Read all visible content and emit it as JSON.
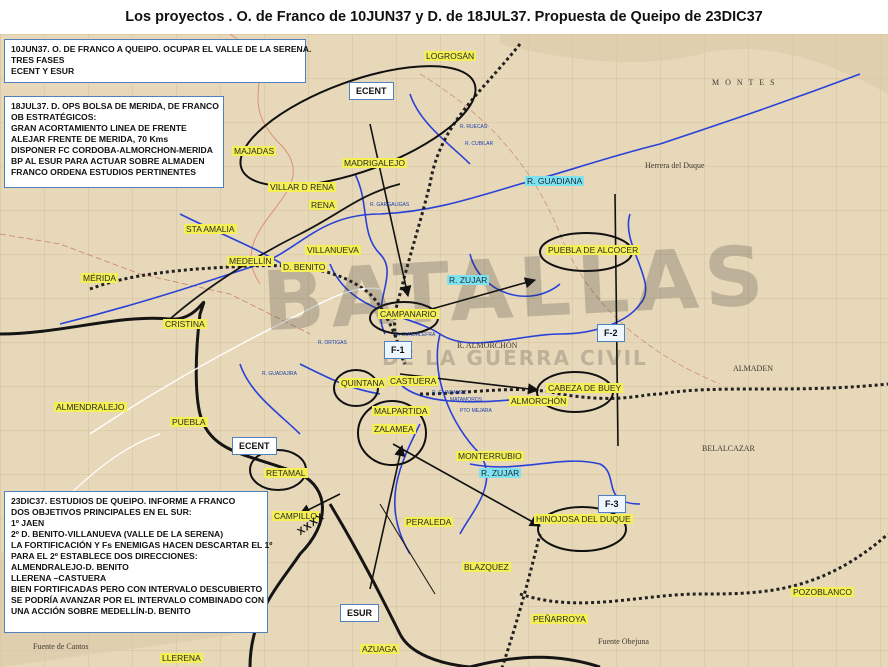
{
  "title": "Los proyectos . O. de Franco de 10JUN37  y D. de 18JUL37. Propuesta de Queipo de 23DIC37",
  "watermark": {
    "line1": "BATALLAS",
    "line2": "DE LA GUERRA CIVIL"
  },
  "panels": {
    "jun": [
      "10JUN37. O. DE FRANCO A QUEIPO. OCUPAR EL VALLE DE LA SERENA.",
      "TRES FASES",
      "ECENT Y ESUR"
    ],
    "jul": [
      "18JUL37. D.  OPS  BOLSA DE MERIDA,  DE FRANCO",
      "OB ESTRATÉGICOS:",
      "GRAN ACORTAMIENTO LINEA DE FRENTE",
      "ALEJAR FRENTE  DE MERIDA, 70 Kms",
      "DISPONER FC CORDOBA-ALMORCHON-MERIDA",
      "BP AL ESUR  PARA ACTUAR SOBRE ALMADEN",
      "FRANCO ORDENA ESTUDIOS PERTINENTES"
    ],
    "dic": [
      "23DIC37. ESTUDIOS DE QUEIPO. INFORME A FRANCO",
      "DOS OBJETIVOS PRINCIPALES EN EL SUR:",
      "1º JAEN",
      "2º D. BENITO-VILLANUEVA (VALLE DE LA SERENA)",
      "LA FORTIFICACIÓN Y Fs ENEMIGAS HACEN DESCARTAR EL 1º",
      "PARA EL 2º ESTABLECE DOS DIRECCIONES:",
      "ALMENDRALEJO-D. BENITO",
      "LLERENA –CASTUERA",
      "BIEN FORTIFICADAS PERO CON INTERVALO DESCUBIERTO",
      "SE PODRÍA AVANZAR POR EL INTERVALO COMBINADO CON",
      "UNA ACCIÓN SOBRE MEDELLÍN-D. BENITO"
    ]
  },
  "tags": {
    "ecent_n": "ECENT",
    "ecent_s": "ECENT",
    "esur": "ESUR",
    "f1": "F-1",
    "f2": "F-2",
    "f3": "F-3"
  },
  "xxxx": "XXXX",
  "places": {
    "logrosan": "LOGROSÁN",
    "majadas": "MAJADAS",
    "madrigalejo": "MADRIGALEJO",
    "villar": "VILLAR D RENA",
    "rena": "RENA",
    "sta_amalia": "STA AMALIA",
    "medellin": "MEDELLÍN",
    "villanueva": "VILLANUEVA",
    "don_benito": "D. BENITO",
    "merida": "MÉRIDA",
    "cristina": "CRISTINA",
    "campanario": "CAMPANARIO",
    "quintana": "QUINTANA",
    "castuera": "CASTUERA",
    "almendralejo": "ALMENDRALEJO",
    "puebla": "PUEBLA",
    "zalamea": "ZALAMEA",
    "malpartida": "MALPARTIDA",
    "almorchon": "ALMORCHÓN",
    "cabeza_buey": "CABEZA DE BUEY",
    "puebla_alcocer": "PUEBLA DE ALCOCER",
    "monterrubio": "MONTERRUBIO",
    "retamal": "RETAMAL",
    "campillo": "CAMPILLO",
    "peraleda": "PERALEDA",
    "hinojosa": "HINOJOSA DEL DUQUE",
    "blazquez": "BLAZQUEZ",
    "penarroya": "PEÑARROYA",
    "pozoblanco": "POZOBLANCO",
    "azuaga": "AZUAGA",
    "llerena": "LLERENA"
  },
  "rivers": {
    "guadiana": "R. GUADIANA",
    "zujar_n": "R. ZUJAR",
    "zujar_s": "R. ZUJAR",
    "almorchon": "R. ALMORCHÓN"
  },
  "base_labels": {
    "herrera": "Herrera del Duque",
    "belalcazar": "BELALCAZAR",
    "almaden": "ALMADEN",
    "fuente": "Fuente de Cantos",
    "fuenteobejuna": "Fuente Obejuna",
    "montes": "M O N T E S"
  },
  "tiny_labels": [
    "R. RUECAS",
    "R. CUBILAR",
    "R. GARGALIGAS",
    "R. GUADALEFRA",
    "R. ORTIGAS",
    "R. GUADAMEZ",
    "R. GUADAJIRA",
    "PTO MEJARA",
    "MATAMOROS"
  ],
  "colors": {
    "map_paper": "#e7d8b9",
    "front_line": "#151515",
    "river": "#2a41d8",
    "tag_border": "#4f81bd",
    "place_fill": "#f3ef55",
    "river_fill": "#7fe3ef"
  }
}
